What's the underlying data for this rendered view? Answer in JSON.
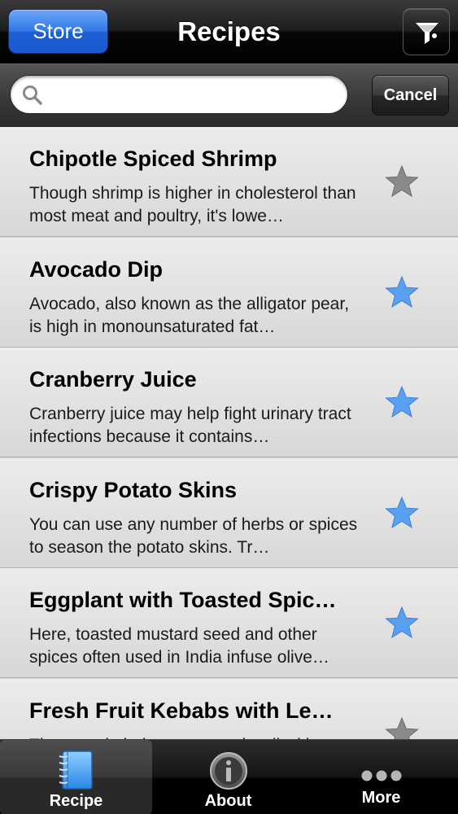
{
  "navbar": {
    "store_label": "Store",
    "title": "Recipes",
    "filter_icon": "funnel-icon"
  },
  "search": {
    "value": "",
    "placeholder": "",
    "cancel_label": "Cancel"
  },
  "recipes": [
    {
      "title": "Chipotle Spiced Shrimp",
      "description": "Though shrimp is higher in cholesterol than most meat and poultry, it's lowe…",
      "favorite": false
    },
    {
      "title": "Avocado Dip",
      "description": "Avocado, also known as the alligator pear, is high in monounsaturated fat…",
      "favorite": true
    },
    {
      "title": "Cranberry Juice",
      "description": "Cranberry juice may help fight urinary tract infections because it contains…",
      "favorite": true
    },
    {
      "title": "Crispy Potato Skins",
      "description": "You can use any number of herbs or spices to season the potato skins. Tr…",
      "favorite": true
    },
    {
      "title": "Eggplant with Toasted Spic…",
      "description": "Here, toasted mustard seed and other spices often used in India infuse olive…",
      "favorite": true
    },
    {
      "title": "Fresh Fruit Kebabs with Le…",
      "description": "The oven kebabs are served well with yogurt…",
      "favorite": false
    }
  ],
  "tabs": [
    {
      "label": "Recipe",
      "icon": "recipe-book-icon",
      "selected": true
    },
    {
      "label": "About",
      "icon": "info-icon",
      "selected": false
    },
    {
      "label": "More",
      "icon": "more-dots-icon",
      "selected": false
    }
  ],
  "colors": {
    "accent_blue": "#2f77e8",
    "star_favorite": "#5aa0f0",
    "star_default": "#8a8a8a"
  }
}
